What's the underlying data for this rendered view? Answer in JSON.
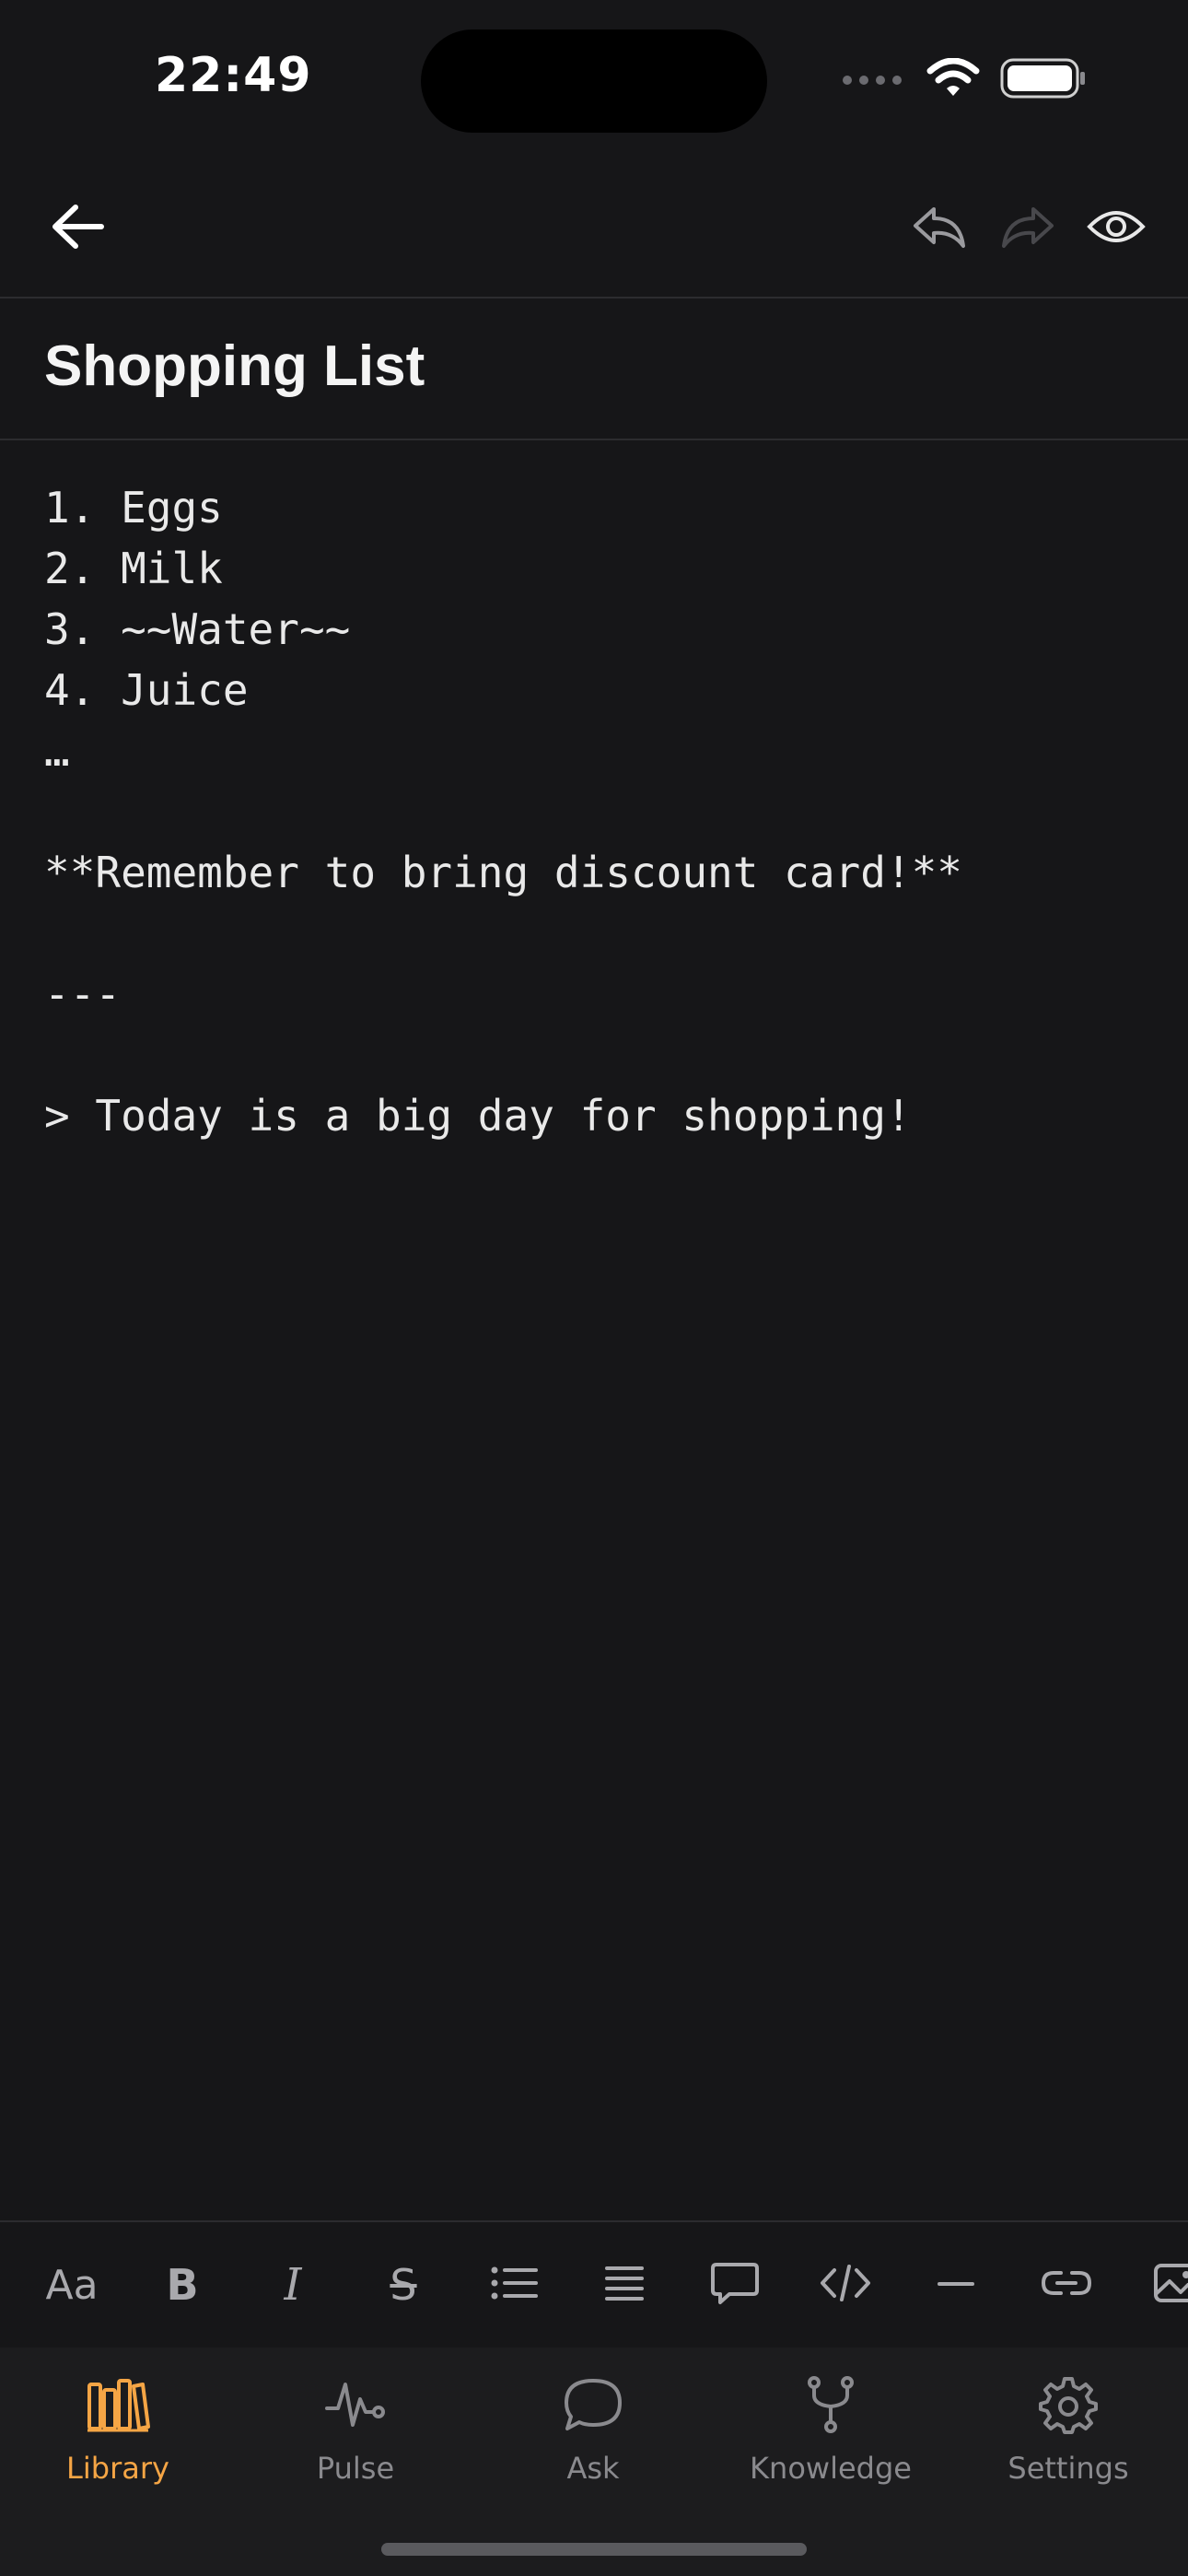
{
  "status_bar": {
    "time": "22:49"
  },
  "nav": {
    "back_icon": "arrow-left-icon",
    "undo_icon": "undo-icon",
    "redo_icon": "redo-icon",
    "preview_icon": "eye-icon"
  },
  "note": {
    "title": "Shopping List",
    "lines": [
      "1. Eggs",
      "2. Milk",
      "3. ~~Water~~",
      "4. Juice",
      "…",
      "",
      "**Remember to bring discount card!**",
      "",
      "---",
      "",
      "> Today is a big day for shopping!"
    ]
  },
  "format_toolbar": {
    "items": [
      {
        "icon": "text-style-icon",
        "label": "Aa"
      },
      {
        "icon": "bold-icon",
        "label": "B"
      },
      {
        "icon": "italic-icon",
        "label": "I"
      },
      {
        "icon": "strikethrough-icon",
        "label": "S"
      },
      {
        "icon": "bullet-list-icon"
      },
      {
        "icon": "paragraph-lines-icon"
      },
      {
        "icon": "comment-icon"
      },
      {
        "icon": "code-icon"
      },
      {
        "icon": "horizontal-rule-icon"
      },
      {
        "icon": "link-icon"
      },
      {
        "icon": "image-icon"
      }
    ]
  },
  "tabs": [
    {
      "label": "Library",
      "icon": "library-books-icon",
      "active": true
    },
    {
      "label": "Pulse",
      "icon": "pulse-icon",
      "active": false
    },
    {
      "label": "Ask",
      "icon": "chat-bubble-icon",
      "active": false
    },
    {
      "label": "Knowledge",
      "icon": "branch-icon",
      "active": false
    },
    {
      "label": "Settings",
      "icon": "gear-icon",
      "active": false
    }
  ],
  "colors": {
    "background": "#161618",
    "accent": "#f5a545",
    "inactive": "#8a8a8e",
    "divider": "#2c2c2f"
  }
}
